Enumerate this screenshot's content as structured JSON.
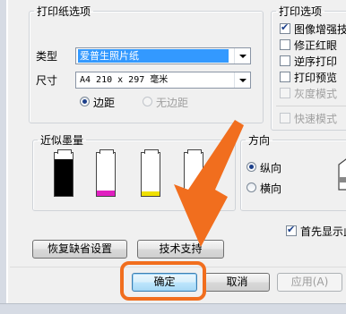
{
  "paper_options": {
    "legend": "打印纸选项",
    "type_label": "类型",
    "type_value": "爱普生照片纸",
    "size_label": "尺寸",
    "size_value": "A4 210 x 297 毫米",
    "margin_label": "边距",
    "borderless_label": "无边距"
  },
  "print_options": {
    "legend": "打印选项",
    "items": [
      {
        "label": "图像增强技",
        "checked": true,
        "enabled": true
      },
      {
        "label": "修正红眼",
        "checked": false,
        "enabled": true
      },
      {
        "label": "逆序打印",
        "checked": false,
        "enabled": true
      },
      {
        "label": "打印预览",
        "checked": false,
        "enabled": true
      },
      {
        "label": "灰度模式",
        "checked": false,
        "enabled": false
      }
    ],
    "quick_mode_label": "快速模式"
  },
  "ink_levels": {
    "legend": "近似墨量",
    "cartridges": [
      {
        "name": "black",
        "color": "#000000",
        "level": 0.85
      },
      {
        "name": "magenta",
        "color": "#e020c0",
        "level": 0.12
      },
      {
        "name": "yellow",
        "color": "#f0e000",
        "level": 0.1
      },
      {
        "name": "cyan",
        "color": "#00c0d0",
        "level": 0.1
      }
    ]
  },
  "orientation": {
    "legend": "方向",
    "portrait_label": "纵向",
    "landscape_label": "横向"
  },
  "show_first_label": "首先显示此",
  "buttons": {
    "restore_defaults": "恢复缺省设置",
    "tech_support": "技术支持",
    "ok": "确定",
    "cancel": "取消",
    "apply": "应用(A)"
  },
  "colors": {
    "arrow": "#f16e1e",
    "selection": "#3399ff"
  }
}
